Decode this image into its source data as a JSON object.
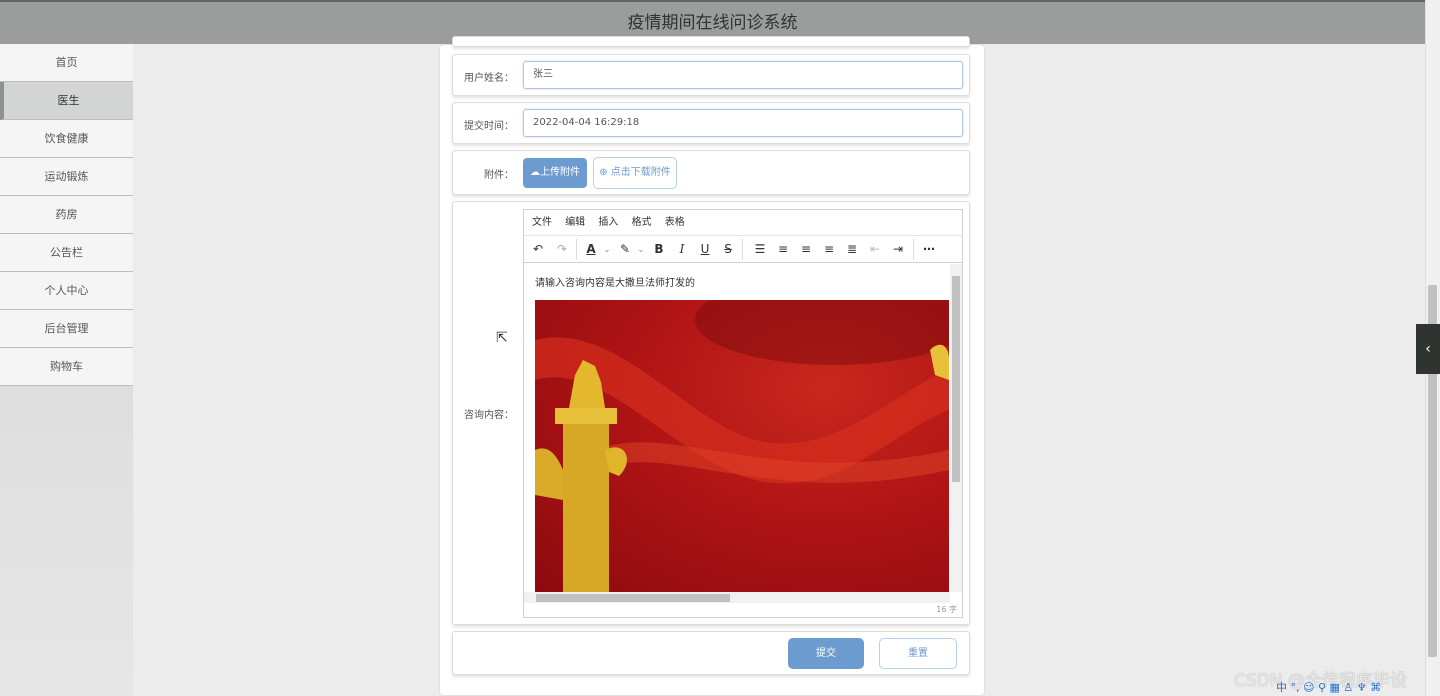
{
  "app": {
    "title": "疫情期间在线问诊系统"
  },
  "sidebar": {
    "items": [
      {
        "label": "首页",
        "active": false
      },
      {
        "label": "医生",
        "active": true
      },
      {
        "label": "饮食健康",
        "active": false
      },
      {
        "label": "运动锻炼",
        "active": false
      },
      {
        "label": "药房",
        "active": false
      },
      {
        "label": "公告栏",
        "active": false
      },
      {
        "label": "个人中心",
        "active": false
      },
      {
        "label": "后台管理",
        "active": false
      },
      {
        "label": "购物车",
        "active": false
      }
    ]
  },
  "form": {
    "username": {
      "label": "用户姓名：",
      "value": "张三"
    },
    "submit_time": {
      "label": "提交时间：",
      "value": "2022-04-04 16:29:18"
    },
    "attachment": {
      "label": "附件：",
      "upload_label": "上传附件",
      "download_label": "点击下载附件"
    },
    "content": {
      "label": "咨询内容：",
      "menu": [
        "文件",
        "编辑",
        "插入",
        "格式",
        "表格"
      ],
      "text": "请输入咨询内容是大撒旦法师打发的",
      "word_count": "16 字"
    },
    "submit_label": "提交",
    "reset_label": "重置"
  },
  "overlay": {
    "watermark": "CSDN @全传程序毕设",
    "tray": "中 °, ☺ ⚲ ▦ ♙ ♆ ⌘"
  },
  "colors": {
    "header_bg": "#9a9d9b",
    "primary": "#6c9bd0",
    "active_nav": "#d2d5d3"
  }
}
